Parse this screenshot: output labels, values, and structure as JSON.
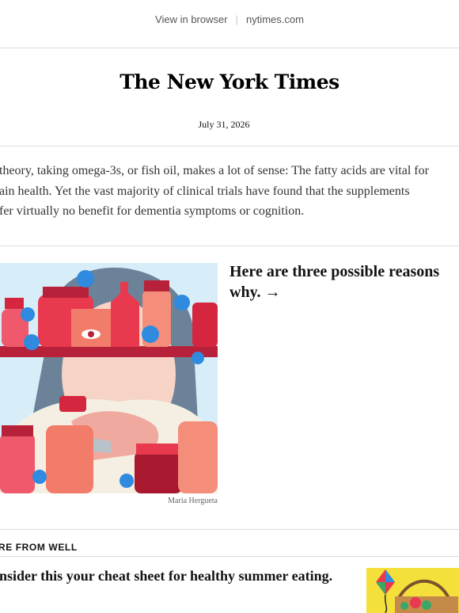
{
  "header": {
    "view_in_browser": "View in browser",
    "separator": "|",
    "site_link": "nytimes.com"
  },
  "masthead": {
    "logo_text": "The New York Times",
    "date": "July 31, 2026"
  },
  "article": {
    "intro_lines": [
      "theory, taking omega-3s, or fish oil, makes a lot of sense: The fatty acids are vital for",
      "ain health. Yet the vast majority of clinical trials have found that the supplements",
      "fer virtually no benefit for dementia symptoms or cognition."
    ],
    "headline": "Here are three possible reasons why. →",
    "image_credit": "Maria Hergueta",
    "image_icon": "supplement-bottles-illustration"
  },
  "more_from_well": {
    "section_label": "ORE FROM WELL",
    "item_headline": "onsider this your cheat sheet for healthy summer eating.",
    "thumbnail_icon": "picnic-basket-illustration"
  },
  "colors": {
    "divider": "#dcdcdc",
    "text": "#121212",
    "muted": "#555555",
    "illustration_bg": "#d7eef8",
    "thumbnail_bg": "#f5df3a"
  }
}
